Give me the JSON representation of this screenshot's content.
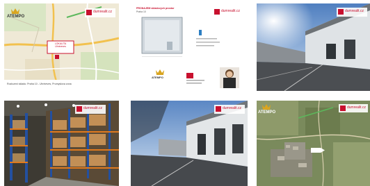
{
  "brand": {
    "logo_text": "ATEMPO",
    "agency_text": "dumrealit.cz",
    "accent": "#c8102e",
    "gold": "#d9a520"
  },
  "thumbnails": [
    {
      "label": "map-overview",
      "map_pin_line1": "LOKALITA",
      "map_pin_line2": "Uhrineves",
      "map_caption": "Rozlozeni skladu: Praha 10 - Uhrineves, Prumyslova zona"
    },
    {
      "label": "floor-plan-document",
      "doc_title": "PRONAJEM skladovych prostor",
      "doc_subtitle": "Praha 10"
    },
    {
      "label": "warehouse-exterior-1"
    },
    {
      "label": "warehouse-interior-racks"
    },
    {
      "label": "warehouse-exterior-2"
    },
    {
      "label": "satellite-map"
    }
  ]
}
